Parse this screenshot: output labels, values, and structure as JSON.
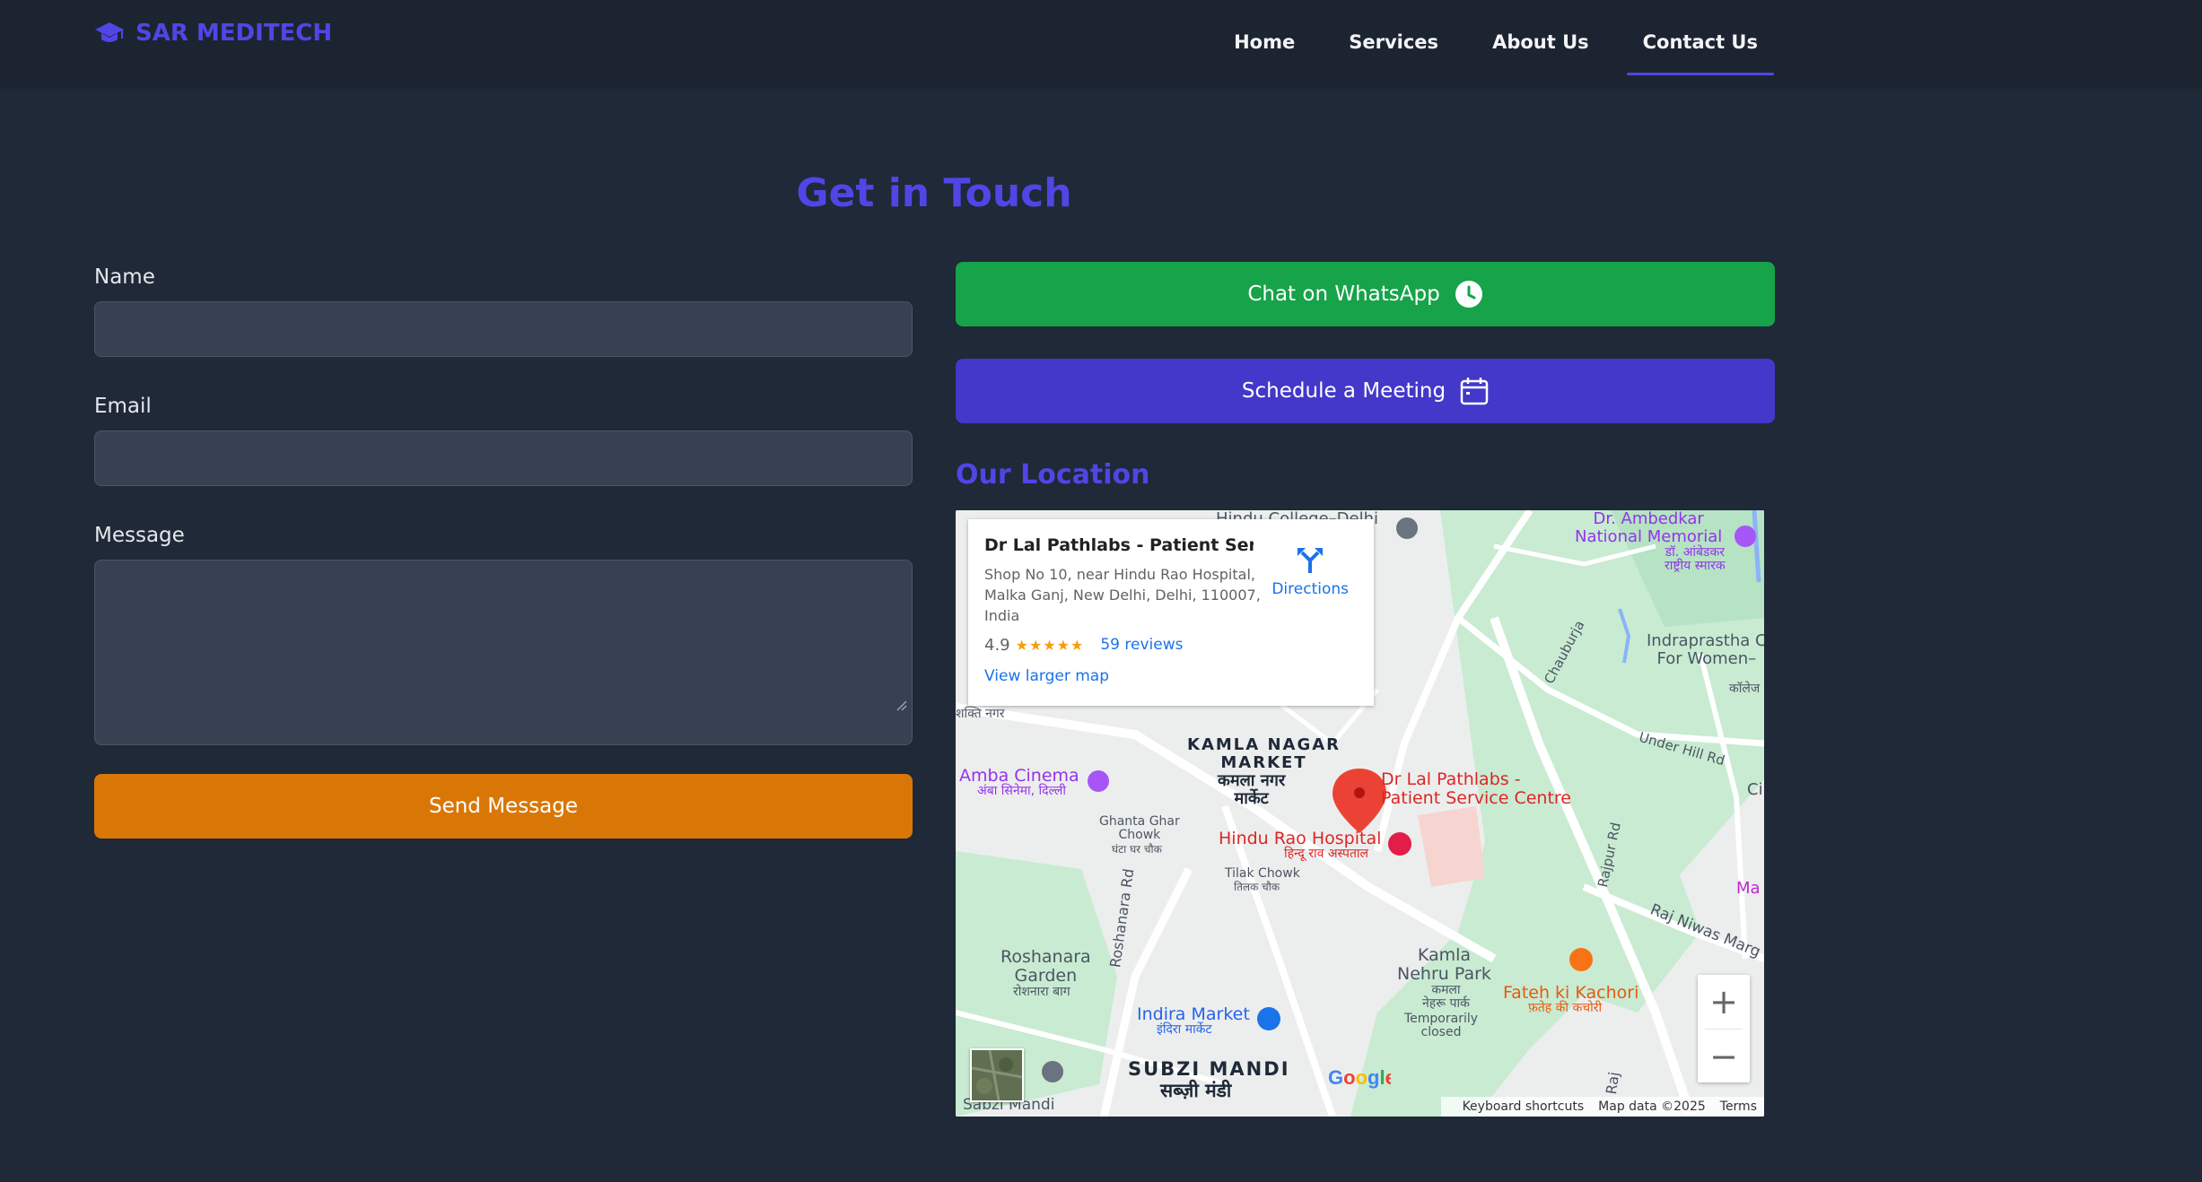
{
  "nav": {
    "brand": "SAR MEDITECH",
    "links": [
      "Home",
      "Services",
      "About Us",
      "Contact Us"
    ],
    "active": "Contact Us"
  },
  "page": {
    "title": "Get in Touch"
  },
  "form": {
    "name_label": "Name",
    "email_label": "Email",
    "message_label": "Message",
    "name_value": "",
    "email_value": "",
    "message_value": "",
    "submit_label": "Send Message"
  },
  "actions": {
    "whatsapp_label": "Chat on WhatsApp",
    "meeting_label": "Schedule a Meeting"
  },
  "location": {
    "title": "Our Location",
    "card": {
      "title": "Dr Lal Pathlabs - Patient Servi...",
      "address": "Shop No 10, near Hindu Rao Hospital, Malka Ganj, New Delhi, Delhi, 110007, India",
      "rating": "4.9",
      "stars": "★★★★★",
      "reviews": "59 reviews",
      "directions": "Directions",
      "larger_map": "View larger map"
    },
    "map_labels": {
      "hindu_college": "Hindu College–Delhi",
      "ambedkar": "Dr. Ambedkar\nNational Memorial",
      "ambedkar_hi": "डॉ. आंबेडकर\nराष्ट्रीय स्मारक",
      "chauburja": "Chauburja",
      "indraprastha": "Indraprastha C\nFor Women–",
      "college_hi": "कॉलेज",
      "under_hill": "Under Hill Rd",
      "shakti": "शक्ति नगर",
      "kamla_market": "KAMLA NAGAR\nMARKET",
      "kamla_market_hi": "कमला नगर\nमार्केट",
      "amba": "Amba Cinema",
      "amba_hi": "अंबा सिनेमा, दिल्ली",
      "lal_path": "Dr Lal Pathlabs -\nPatient Service Centre",
      "ghanta": "Ghantа Ghar\nChowk",
      "ghanta_hi": "घंटा घर चौक",
      "hindu_rao": "Hindu Rao Hospital",
      "hindu_rao_hi": "हिन्दू राव अस्पताल",
      "tilak": "Tilak Chowk",
      "tilak_hi": "तिलक चौक",
      "rajpur": "Rajpur Rd",
      "roshanara_rd": "Roshanara Rd",
      "roshanara": "Roshanara\nGarden",
      "roshanara_hi": "रोशनारा बाग",
      "kamla_park": "Kamla\nNehru Park",
      "kamla_park_hi": "कमला\nनेहरू पार्क",
      "temp_closed": "Temporarily\nclosed",
      "fateh": "Fateh ki Kachori",
      "fateh_hi": "फ़तेह की कचोरी",
      "raj_niwas": "Raj Niwas Marg",
      "indira": "Indira Market",
      "indira_hi": "इंदिरा मार्केट",
      "subzi": "SUBZI MANDI",
      "subzi_hi": "सब्ज़ी मंडी",
      "subzi_small": "Sabzi Mandi",
      "ma": "Ma",
      "ci": "Ci",
      "raj": "Raj"
    },
    "footer": [
      "Keyboard shortcuts",
      "Map data ©2025",
      "Terms"
    ]
  },
  "colors": {
    "background": "#1f2937",
    "accent": "#4f46e5",
    "whatsapp": "#16a34a",
    "meeting": "#4338ca",
    "send": "#d97706"
  }
}
